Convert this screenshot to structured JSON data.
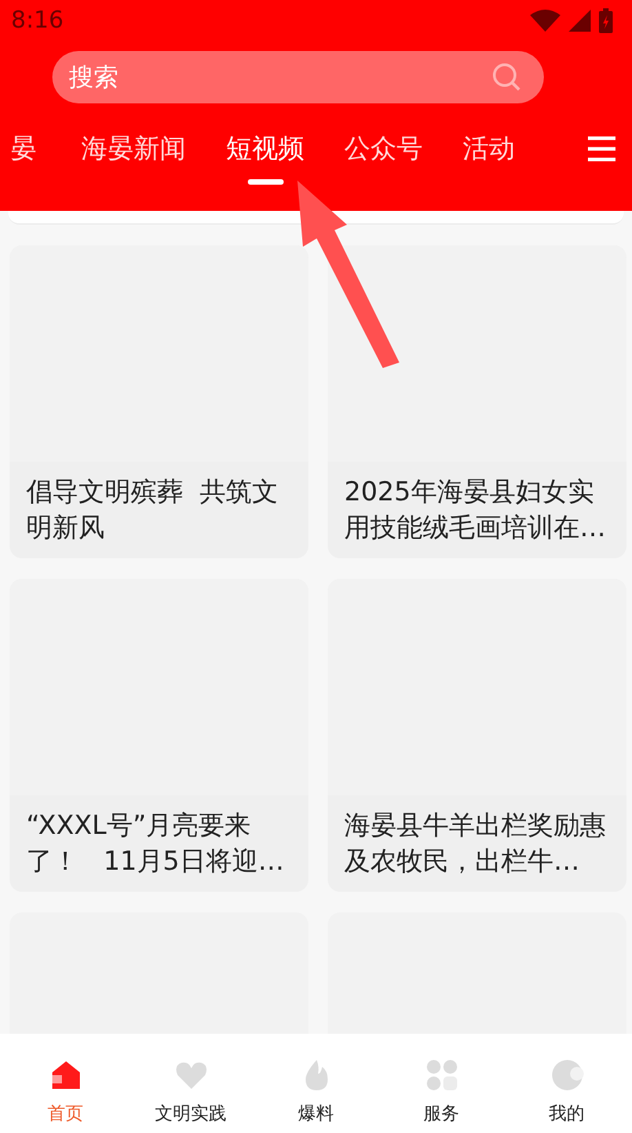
{
  "status_bar": {
    "time": "8:16"
  },
  "search": {
    "placeholder": "搜索"
  },
  "tabs": [
    {
      "label": "晏",
      "selected": false
    },
    {
      "label": "海晏新闻",
      "selected": false
    },
    {
      "label": "短视频",
      "selected": true
    },
    {
      "label": "公众号",
      "selected": false
    },
    {
      "label": "活动",
      "selected": false
    }
  ],
  "cards": [
    {
      "kind": "full",
      "title": "倡导文明殡葬  共筑文明新风"
    },
    {
      "kind": "full",
      "title": "2025年海晏县妇女实用技能绒毛画培训在…"
    },
    {
      "kind": "full",
      "title": "“XXXL号”月亮要来了！   11月5日将迎…"
    },
    {
      "kind": "full",
      "title": "海晏县牛羊出栏奖励惠及农牧民，出栏牛…"
    },
    {
      "kind": "partial"
    },
    {
      "kind": "partial"
    }
  ],
  "nav": [
    {
      "label": "首页",
      "kind": "home",
      "selected": true
    },
    {
      "label": "文明实践",
      "kind": "heart",
      "selected": false
    },
    {
      "label": "爆料",
      "kind": "flame",
      "selected": false
    },
    {
      "label": "服务",
      "kind": "grid",
      "selected": false
    },
    {
      "label": "我的",
      "kind": "moon",
      "selected": false
    }
  ]
}
